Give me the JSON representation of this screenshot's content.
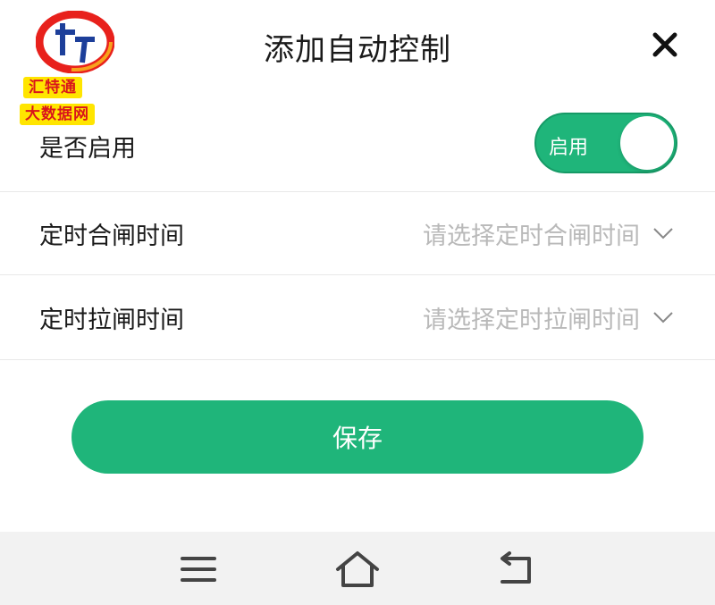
{
  "logo": {
    "line1": "汇特通",
    "line2": "大数据网"
  },
  "header": {
    "title": "添加自动控制"
  },
  "enable_row": {
    "label": "是否启用",
    "toggle_text": "启用",
    "enabled": true
  },
  "close_time_row": {
    "label": "定时合闸时间",
    "placeholder": "请选择定时合闸时间"
  },
  "open_time_row": {
    "label": "定时拉闸时间",
    "placeholder": "请选择定时拉闸时间"
  },
  "save_button": {
    "label": "保存"
  },
  "colors": {
    "accent": "#1fb57a",
    "placeholder": "#b9b9b9",
    "navbar_bg": "#f2f2f2"
  },
  "icons": {
    "close": "close-icon",
    "chevron": "chevron-down-icon",
    "menu": "menu-icon",
    "home": "home-icon",
    "back": "back-icon"
  }
}
